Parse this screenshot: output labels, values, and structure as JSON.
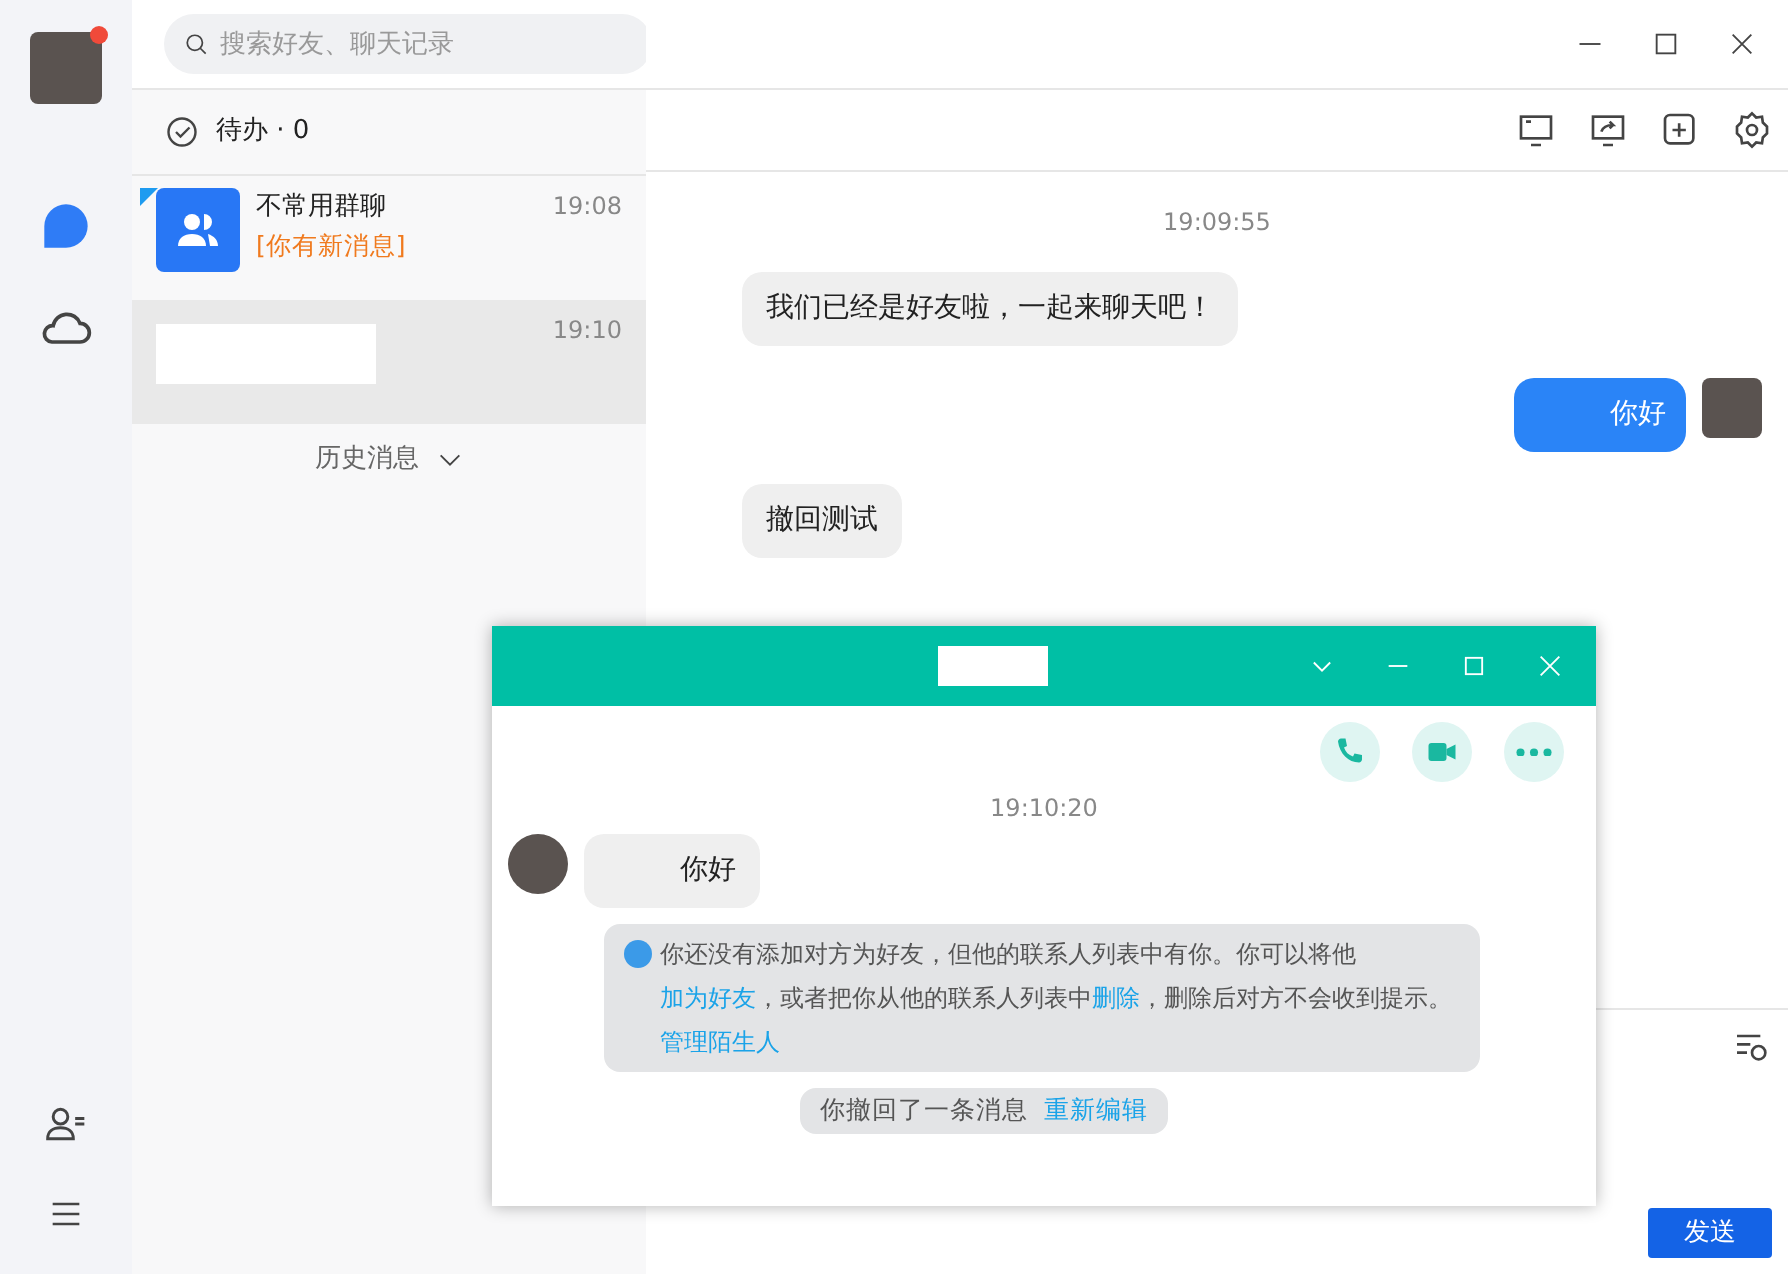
{
  "search": {
    "placeholder": "搜索好友、聊天记录"
  },
  "profile": {
    "badge": true
  },
  "todo": {
    "label": "待办 · 0"
  },
  "conversations": [
    {
      "kind": "group",
      "title": "不常用群聊",
      "preview": "[你有新消息]",
      "time": "19:08",
      "selected": false,
      "flagged": true
    },
    {
      "kind": "hidden",
      "time": "19:10",
      "selected": true,
      "flagged": false
    }
  ],
  "history": {
    "label": "历史消息"
  },
  "chat": {
    "messages": [
      {
        "kind": "time",
        "text": "19:09:55"
      },
      {
        "kind": "in",
        "text": "我们已经是好友啦，一起来聊天吧！"
      },
      {
        "kind": "out",
        "text": "你好"
      },
      {
        "kind": "in",
        "text": "撤回测试"
      }
    ],
    "send": "发送"
  },
  "popup": {
    "time": "19:10:20",
    "message": {
      "text": "你好"
    },
    "notice": [
      {
        "text": "你还没有添加对方为好友，但他的联系人列表中有你。你可以将他",
        "link": false
      },
      {
        "text": "加为好友",
        "link": true
      },
      {
        "text": "，或者把你从他的联系人列表中",
        "link": false
      },
      {
        "text": "删除",
        "link": true
      },
      {
        "text": "，删除后对方不会收到提示。",
        "link": false
      },
      {
        "text": "管理陌生人",
        "link": true
      }
    ],
    "recall": {
      "text": "你撤回了一条消息",
      "link": "重新编辑"
    }
  }
}
